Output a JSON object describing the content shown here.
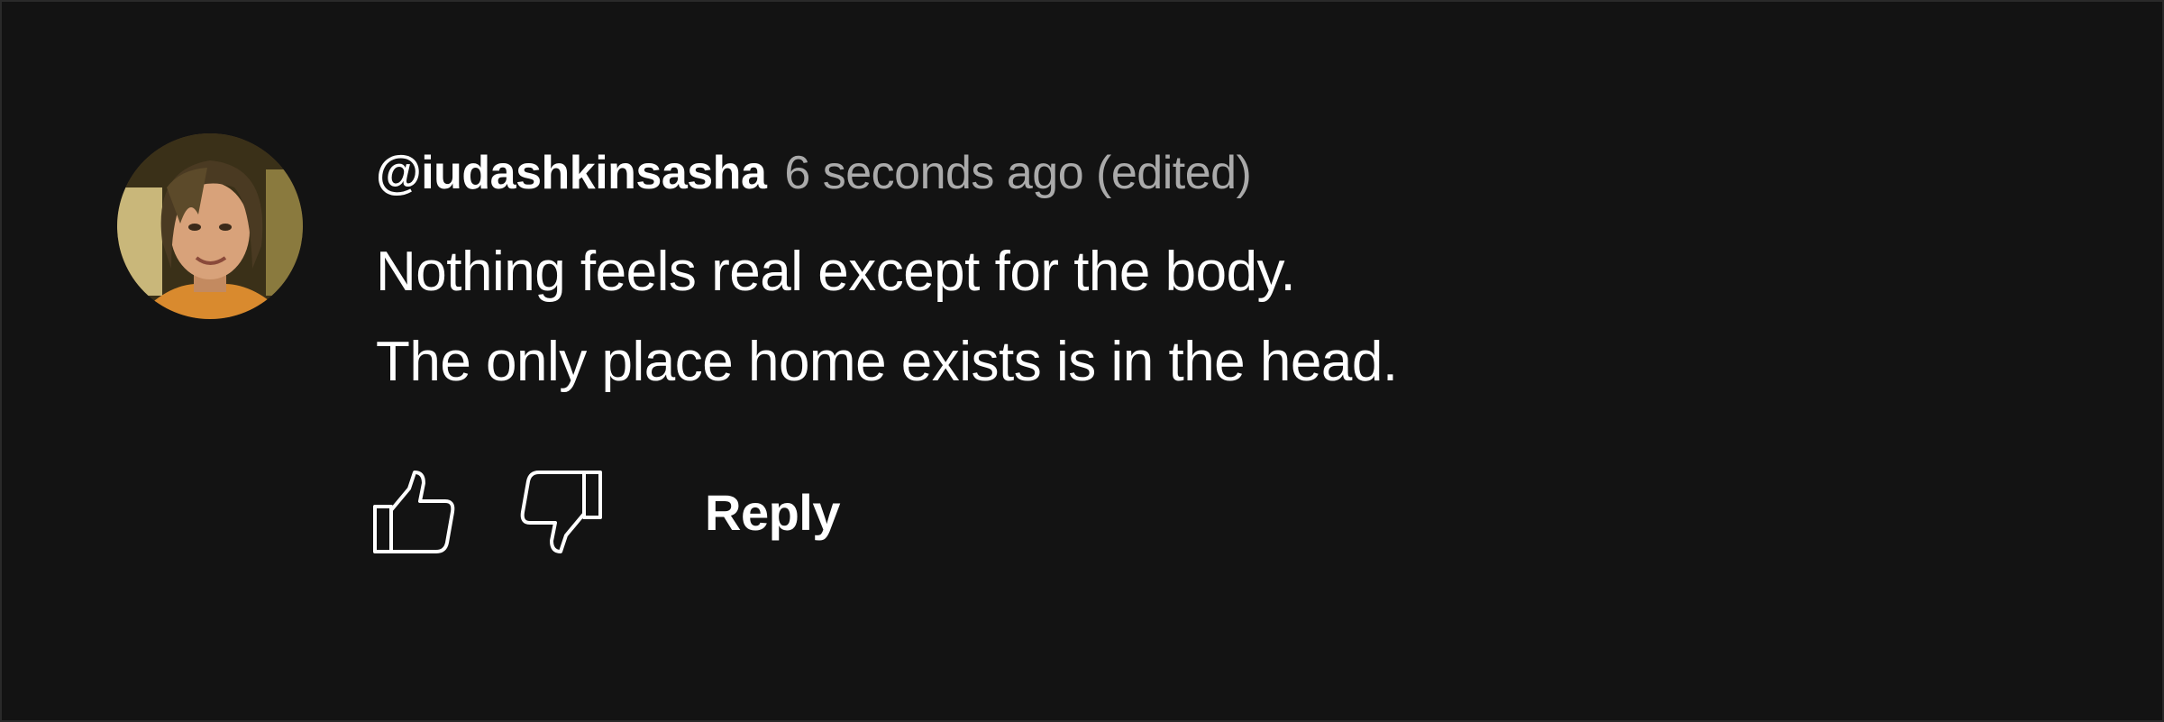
{
  "comment": {
    "author_handle": "@iudashkinsasha",
    "timestamp": "6 seconds ago (edited)",
    "text_lines": [
      "Nothing feels real except for the body.",
      "The only place home exists is in the head."
    ],
    "avatar": "profile-photo"
  },
  "actions": {
    "like_icon": "thumbs-up-icon",
    "dislike_icon": "thumbs-down-icon",
    "reply_label": "Reply"
  },
  "colors": {
    "background": "#131313",
    "text_primary": "#ffffff",
    "text_secondary": "#aaaaaa"
  }
}
